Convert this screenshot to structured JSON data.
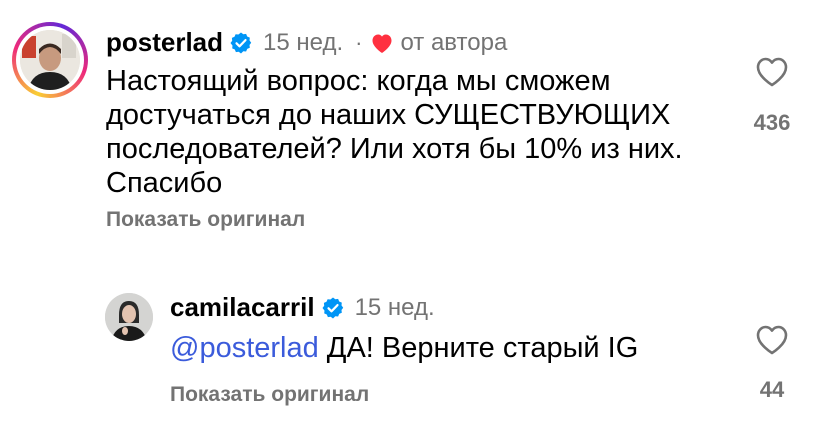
{
  "comments": [
    {
      "username": "posterlad",
      "time": "15 нед.",
      "separator": "·",
      "author_label": "от автора",
      "text_lines": [
        "Настоящий вопрос: когда мы сможем",
        "достучаться до наших СУЩЕСТВУЮЩИХ",
        "последователей? Или хотя бы 10% из них.",
        "Спасибо"
      ],
      "show_original": "Показать оригинал",
      "like_count": "436"
    },
    {
      "username": "camilacarril",
      "time": "15 нед.",
      "mention": "@posterlad",
      "text": " ДА! Верните старый IG",
      "show_original": "Показать оригинал",
      "like_count": "44"
    }
  ],
  "colors": {
    "verified_blue": "#0095f6",
    "author_heart": "#ff3040",
    "secondary_text": "#737373",
    "mention": "#3b5bdb"
  },
  "icons": [
    "verified-badge-icon",
    "heart-filled-icon",
    "heart-outline-icon"
  ]
}
